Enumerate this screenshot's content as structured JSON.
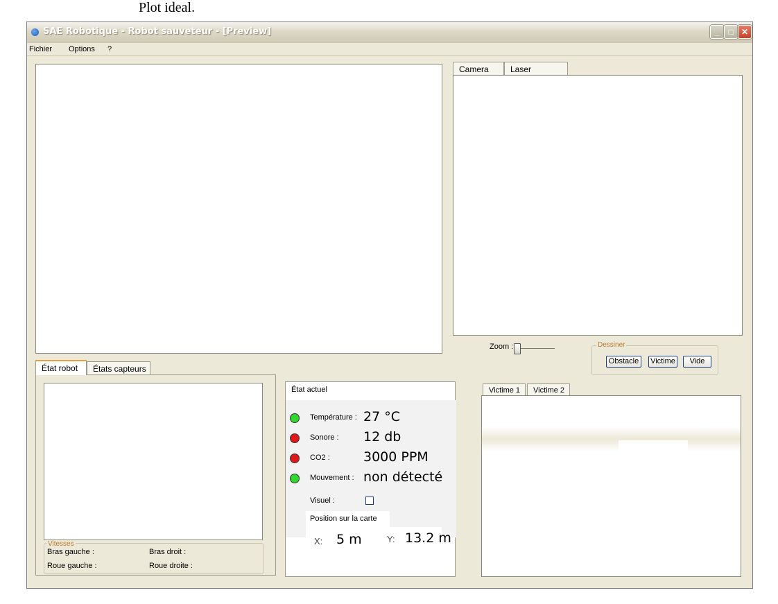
{
  "caption": "Plot ideal.",
  "window": {
    "title": "SAE Robotique - Robot sauveteur - [Preview]"
  },
  "menu": [
    "Fichier",
    "Options",
    "?"
  ],
  "right_tabs": [
    "Camera",
    "Laser"
  ],
  "zoom_label": "Zoom :",
  "dessiner": {
    "legend": "Dessiner",
    "buttons": [
      "Obstacle",
      "Victime",
      "Vide"
    ]
  },
  "left_tabs": [
    "État robot",
    "États capteurs"
  ],
  "vitesses": {
    "legend": "Vitesses",
    "bras_gauche": "Bras gauche :",
    "bras_droit": "Bras droit :",
    "roue_gauche": "Roue gauche :",
    "roue_droite": "Roue droite :"
  },
  "etat_actuel": {
    "title": "État actuel",
    "rows": [
      {
        "label": "Température :",
        "value": "27 °C",
        "status": "green"
      },
      {
        "label": "Sonore :",
        "value": "12 db",
        "status": "red"
      },
      {
        "label": "CO2 :",
        "value": "3000 PPM",
        "status": "red"
      },
      {
        "label": "Mouvement :",
        "value": "non détecté",
        "status": "green"
      }
    ],
    "visuel_label": "Visuel :",
    "visuel_checked": false,
    "position_label": "Position sur la carte",
    "x_label": "X:",
    "x_value": "5 m",
    "y_label": "Y:",
    "y_value": "13.2 m"
  },
  "victim_tabs": [
    "Victime 1",
    "Victime 2"
  ],
  "colors": {
    "led_green": "#2ed82e",
    "led_red": "#e01818",
    "window_bg": "#ece9d8",
    "legend_text": "#b87a2c"
  }
}
